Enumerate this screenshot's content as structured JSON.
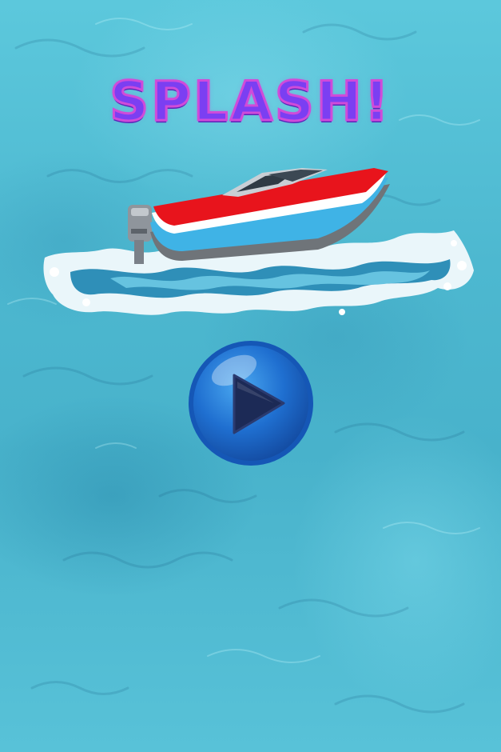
{
  "game": {
    "title": "SPLASH!"
  },
  "icons": {
    "boat": "speedboat-icon",
    "play": "play-icon"
  },
  "colors": {
    "water": "#4db8d0",
    "title_fill": "#7b3ff2",
    "title_outline": "#d04bd9",
    "boat_red": "#e8141c",
    "boat_blue": "#3fb3e6",
    "play_button": "#1f6fd0"
  }
}
